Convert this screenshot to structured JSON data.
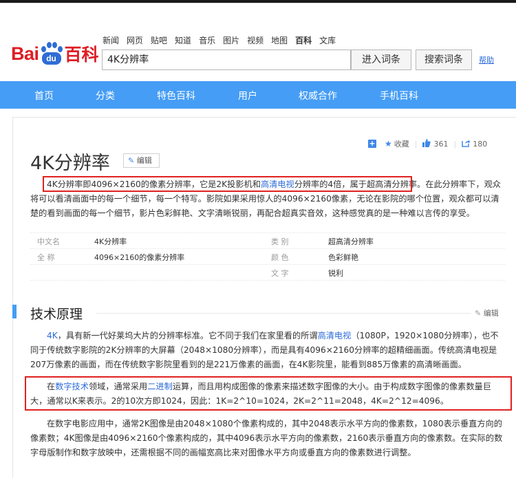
{
  "logo": {
    "bai": "Bai",
    "du": "du",
    "baike": "百科"
  },
  "nav_links": [
    "新闻",
    "网页",
    "贴吧",
    "知道",
    "音乐",
    "图片",
    "视频",
    "地图",
    "百科",
    "文库"
  ],
  "active_nav": "百科",
  "search": {
    "value": "4K分辨率",
    "enter_button": "进入词条",
    "search_button": "搜索词条",
    "help": "帮助"
  },
  "main_nav": [
    "首页",
    "分类",
    "特色百科",
    "用户",
    "权威合作",
    "手机百科"
  ],
  "actions": {
    "plus": "+",
    "favorite": "收藏",
    "likes": "361",
    "shares": "180"
  },
  "title": "4K分辨率",
  "edit_label": "编辑",
  "intro": {
    "p1": "4K分辨率即4096×2160的像素分辨率，它是2K投影机和",
    "link1": "高清电视",
    "p2": "分辨率的4倍，属于超高清分辨率。",
    "p3": "在此分辨率下，观众将可以看清画面中的每一个细节，每一个特写。影院如果采用惊人的4096×2160像素，无论在影院的哪个位置，观众都可以清楚的看到画面的每一个细节，影片色彩鲜艳、文字清晰锐丽，再配合超真实音效，这种感觉真的是一种难以言传的享受。"
  },
  "infobox": [
    {
      "l1": "中文名",
      "v1": "4K分辨率",
      "l2": "类    别",
      "v2": "超高清分辨率"
    },
    {
      "l1": "全    称",
      "v1": "4096×2160的像素分辨率",
      "l2": "颜    色",
      "v2": "色彩鲜艳"
    },
    {
      "l1": "",
      "v1": "",
      "l2": "文    字",
      "v2": "锐利"
    }
  ],
  "section": {
    "title": "技术原理",
    "edit": "编辑"
  },
  "para1": {
    "link_4k": "4K",
    "t1": "，具有新一代好莱坞大片的分辨率标准。它不同于我们在家里看的所谓",
    "link_hdtv": "高清电视",
    "t2": "（1080P，1920×1080分辨率），也不同于传统数字影院的2K分辨率的大屏幕（2048×1080分辨率），而是具有4096×2160分辨率的超精细画面。传统高清电视是207万像素的画面，而在传统数字影院里看到的是221万像素的画面，在4K影院里，能看到885万像素的高清晰画面。"
  },
  "para2": {
    "t0": "在",
    "link_digital": "数字技术",
    "t1": "领域，通常采用",
    "link_binary": "二进制",
    "t2": "运算，而且用构成图像的像素来描述数字图像的大小。由于构成数字图像的像素数量巨大，通常以K来表示。2的10次方即1024，因此：1K=2^10=1024，2K=2^11=2048，4K=2^12=4096。"
  },
  "para3": "在数字电影应用中，通常2K图像是由2048×1080个像素构成的，其中2048表示水平方向的像素数，1080表示垂直方向的像素数；4K图像是由4096×2160个像素构成的，其中4096表示水平方向的像素数，2160表示垂直方向的像素数。在实际的数字母版制作和数字放映中，还需根据不同的画幅宽高比来对图像水平方向或垂直方向的像素数进行调整。"
}
